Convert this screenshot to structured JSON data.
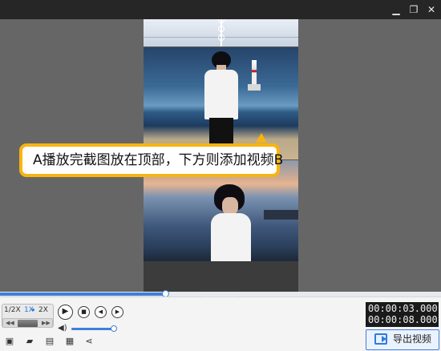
{
  "window": {
    "minimize_icon": "minimize-icon",
    "maximize_icon": "restore-icon",
    "close_icon": "close-icon"
  },
  "preview": {
    "callout_text": "A播放完截图放在顶部，下方则添加视频B"
  },
  "playback": {
    "progress_fraction": 0.375,
    "speed_options": [
      "1/2X",
      "1X",
      "2X"
    ],
    "active_speed": "1X",
    "volume_fraction": 1.0
  },
  "time": {
    "current": "00:00:03.000",
    "total": "00:00:08.000"
  },
  "toolbar": {
    "export_label": "导出视频",
    "tools": [
      "new-project-icon",
      "open-folder-icon",
      "save-icon",
      "save-as-icon",
      "share-icon"
    ]
  },
  "colors": {
    "accent": "#3f7fd9",
    "callout_border": "#f7b411",
    "timecode_bg": "#1a1a1a"
  }
}
